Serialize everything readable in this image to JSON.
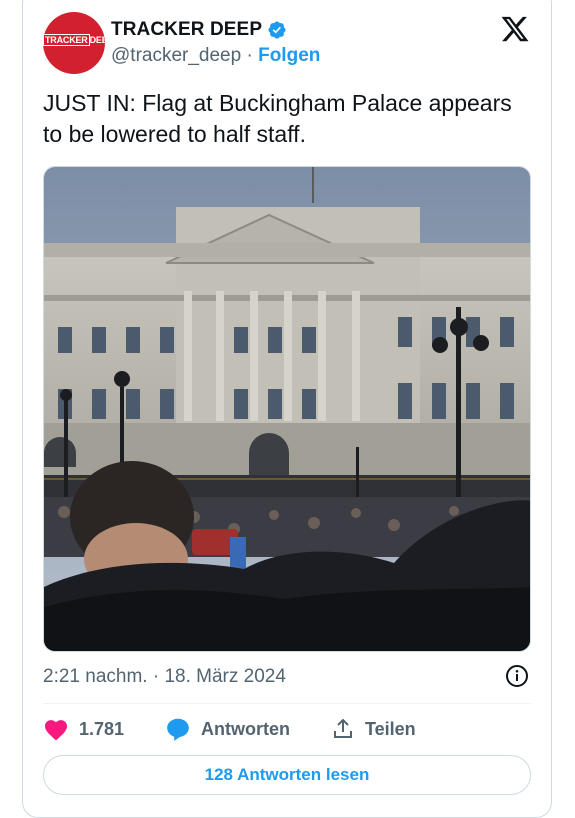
{
  "author": {
    "display_name": "TRACKER DEEP",
    "handle": "@tracker_deep",
    "separator": "·",
    "follow_label": "Folgen",
    "avatar_logo_left": "TRACKER",
    "avatar_logo_right": "DEEP",
    "verified": true
  },
  "tweet": {
    "text": "JUST IN: Flag at Buckingham Palace appears to be lowered to half staff.",
    "timestamp": "2:21 nachm. · 18. März 2024"
  },
  "actions": {
    "likes_count": "1.781",
    "reply_label": "Antworten",
    "share_label": "Teilen"
  },
  "read_replies_label": "128 Antworten lesen",
  "colors": {
    "accent": "#1d9bf0",
    "like": "#f91880",
    "avatar_bg": "#d3202e",
    "text_secondary": "#536471"
  },
  "icons": [
    "verified-badge-icon",
    "x-logo-icon",
    "info-icon",
    "heart-icon",
    "reply-bubble-icon",
    "share-icon"
  ]
}
